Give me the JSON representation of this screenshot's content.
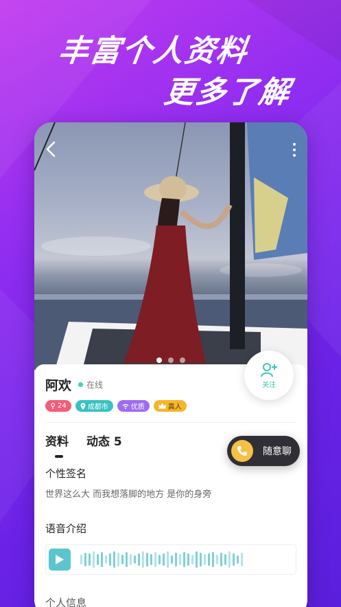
{
  "headline": {
    "line1": "丰富个人资料",
    "line2": "更多了解"
  },
  "profile": {
    "name": "阿欢",
    "status": "在线",
    "follow_label": "关注",
    "photo_count": 3,
    "photo_active": 0,
    "tags": [
      {
        "type": "age",
        "icon": "female-icon",
        "text": "24"
      },
      {
        "type": "city",
        "icon": "location-icon",
        "text": "成都市"
      },
      {
        "type": "quality",
        "icon": "signal-icon",
        "text": "优质"
      },
      {
        "type": "real",
        "icon": "crown-icon",
        "text": "真人"
      }
    ]
  },
  "tabs": [
    {
      "label": "资料",
      "active": true
    },
    {
      "label": "动态 5",
      "active": false
    }
  ],
  "sections": {
    "signature_title": "个性签名",
    "signature_text": "世界这么大 而我想落脚的地方 是你的身旁",
    "voice_title": "语音介绍",
    "info_title": "个人信息"
  },
  "chat_button": {
    "label": "随意聊"
  },
  "colors": {
    "accent": "#3cc3b6",
    "background_start": "#c23bf0",
    "background_end": "#5a1fdc"
  }
}
